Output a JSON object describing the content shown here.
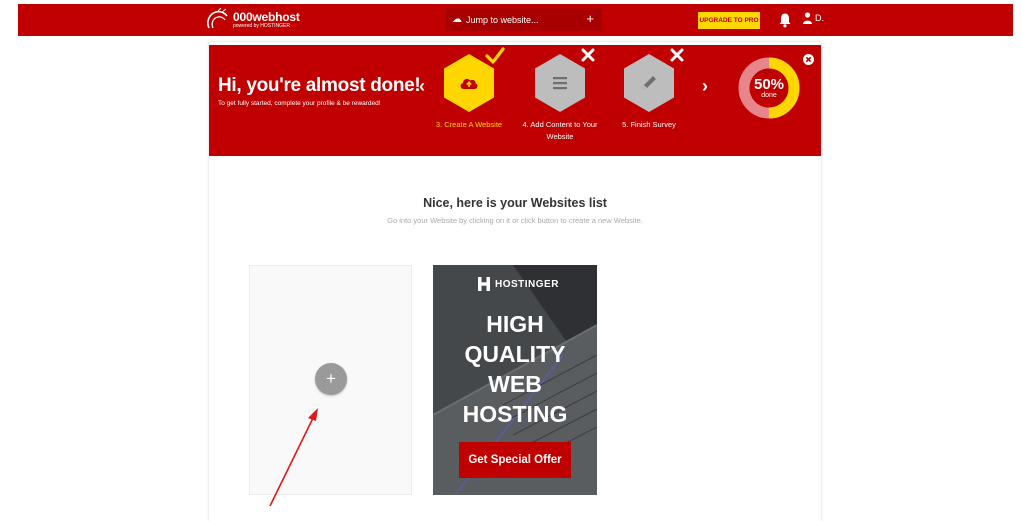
{
  "topbar": {
    "logo_name": "000webhost",
    "logo_sub": "powered by HOSTINGER",
    "jump_label": "Jump to website...",
    "upgrade_label": "UPGRADE TO PRO",
    "user_label": "D."
  },
  "banner": {
    "title": "Hi, you're almost done!",
    "subtitle": "To get fully started, complete your profile & be rewarded!",
    "steps": [
      {
        "label": "3. Create A Website",
        "icon": "cloud-upload-icon",
        "state": "done"
      },
      {
        "label": "4. Add Content to Your Website",
        "icon": "list-icon",
        "state": "skipped"
      },
      {
        "label": "5. Finish Survey",
        "icon": "pencil-icon",
        "state": "skipped"
      }
    ],
    "progress_percent": 50,
    "progress_pct_label": "50%",
    "progress_done_label": "done"
  },
  "websites": {
    "title": "Nice, here is your Websites list",
    "subtitle": "Go into your Website by clicking on it or click button to create a new Website.",
    "add_icon": "+"
  },
  "ad": {
    "brand": "HOSTINGER",
    "headline": [
      "HIGH",
      "QUALITY",
      "WEB",
      "HOSTING"
    ],
    "cta": "Get Special Offer"
  },
  "colors": {
    "brand_red": "#c00000",
    "accent_yellow": "#ffd600",
    "step_grey": "#bdbdbd"
  }
}
